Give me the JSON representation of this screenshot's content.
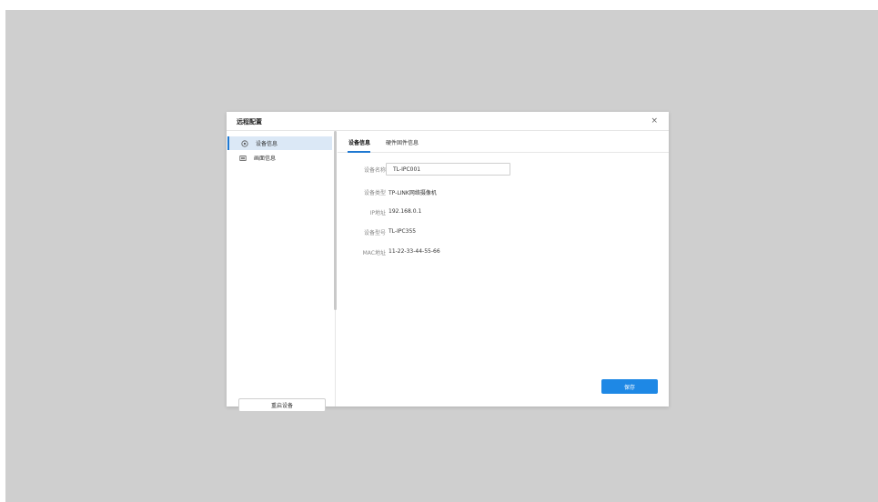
{
  "dialog": {
    "title": "远程配置",
    "close_label": "×"
  },
  "sidebar": {
    "items": [
      {
        "label": "设备信息",
        "icon": "info-circle-icon",
        "active": true
      },
      {
        "label": "画面信息",
        "icon": "monitor-icon",
        "active": false
      }
    ],
    "reboot_label": "重启设备"
  },
  "tabs": [
    {
      "label": "设备信息",
      "active": true
    },
    {
      "label": "硬件固件信息",
      "active": false
    }
  ],
  "form": {
    "device_name": {
      "label": "设备名称",
      "value": "TL-IPC001"
    },
    "device_type": {
      "label": "设备类型",
      "value": "TP-LINK网络摄像机"
    },
    "ip": {
      "label": "IP地址",
      "value": "192.168.0.1"
    },
    "model": {
      "label": "设备型号",
      "value": "TL-IPC355"
    },
    "mac": {
      "label": "MAC地址",
      "value": "11-22-33-44-55-66"
    }
  },
  "save_label": "保存",
  "colors": {
    "accent": "#1e88e5",
    "backdrop": "#cfcfcf",
    "active_item_bg": "#dbe8f6"
  }
}
